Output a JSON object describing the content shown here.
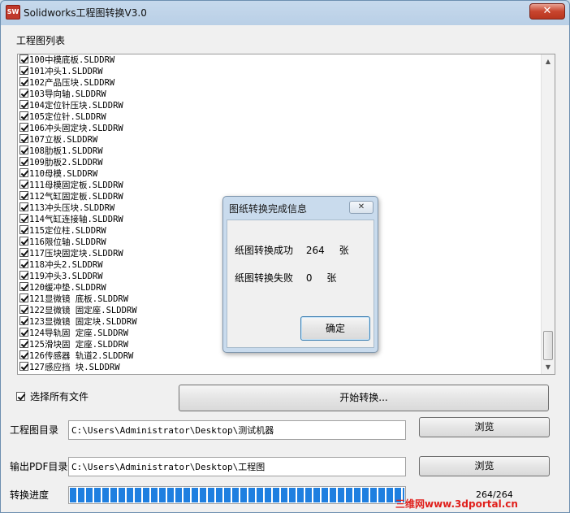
{
  "window": {
    "title": "Solidworks工程图转换V3.0",
    "icon_text": "SW",
    "close_glyph": "✕"
  },
  "drawing_list": {
    "label": "工程图列表",
    "items": [
      "100中模底板.SLDDRW",
      "101冲头1.SLDDRW",
      "102产品压块.SLDDRW",
      "103导向轴.SLDDRW",
      "104定位针压块.SLDDRW",
      "105定位针.SLDDRW",
      "106冲头固定块.SLDDRW",
      "107立板.SLDDRW",
      "108肋板1.SLDDRW",
      "109肋板2.SLDDRW",
      "110母模.SLDDRW",
      "111母模固定板.SLDDRW",
      "112气缸固定板.SLDDRW",
      "113冲头压块.SLDDRW",
      "114气缸连接轴.SLDDRW",
      "115定位柱.SLDDRW",
      "116限位轴.SLDDRW",
      "117压块固定块.SLDDRW",
      "118冲头2.SLDDRW",
      "119冲头3.SLDDRW",
      "120缓冲垫.SLDDRW",
      "121显微镜 底板.SLDDRW",
      "122显微镜 固定座.SLDDRW",
      "123显微镜 固定块.SLDDRW",
      "124导轨固 定座.SLDDRW",
      "125滑块固 定座.SLDDRW",
      "126传感器 轨道2.SLDDRW",
      "127感应挡 块.SLDDRW"
    ]
  },
  "select_all": {
    "label": "选择所有文件",
    "checked": true
  },
  "start_button": {
    "label": "开始转换..."
  },
  "drawing_dir": {
    "label": "工程图目录",
    "value": "C:\\Users\\Administrator\\Desktop\\测试机器",
    "browse_label": "浏览"
  },
  "pdf_dir": {
    "label": "输出PDF目录",
    "value": "C:\\Users\\Administrator\\Desktop\\工程图",
    "browse_label": "浏览"
  },
  "progress": {
    "label": "转换进度",
    "text": "264/264",
    "fraction": 1.0
  },
  "watermark": "三维网www.3dportal.cn",
  "dialog": {
    "title": "图纸转换完成信息",
    "close_glyph": "✕",
    "success_label": "纸图转换成功",
    "success_count": "264",
    "fail_label": "纸图转换失败",
    "fail_count": "0",
    "unit": "张",
    "ok_label": "确定"
  },
  "colors": {
    "progress_fill": "#1e7fe0",
    "title_bar": "#c6d9ec",
    "close_button": "#c8452e",
    "watermark": "#e0201c"
  }
}
